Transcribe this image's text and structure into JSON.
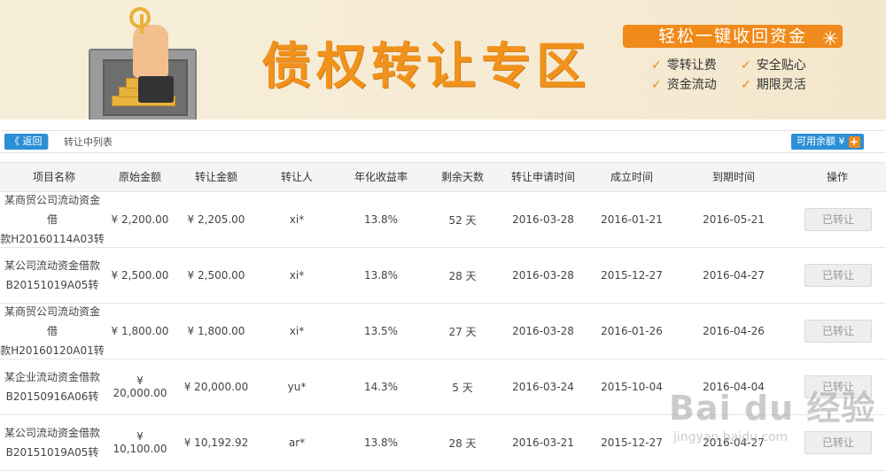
{
  "banner": {
    "title": "债权转让专区",
    "slogan": "轻松一键收回资金",
    "features": [
      "零转让费",
      "安全贴心",
      "资金流动",
      "期限灵活"
    ]
  },
  "toolbar": {
    "back_label": "《 返回",
    "list_label": "转让中列表",
    "balance_label": "可用余额 ¥"
  },
  "table": {
    "headers": [
      "项目名称",
      "原始金额",
      "转让金额",
      "转让人",
      "年化收益率",
      "剩余天数",
      "转让申请时间",
      "成立时间",
      "到期时间",
      "操作"
    ],
    "rows": [
      {
        "name_line1": "某商贸公司流动资金借",
        "name_line2": "款H20160114A03转",
        "original": "¥ 2,200.00",
        "transfer": "¥ 2,205.00",
        "assignor": "xi*",
        "rate": "13.8%",
        "days": "52 天",
        "apply": "2016-03-28",
        "start": "2016-01-21",
        "due": "2016-05-21",
        "action": "已转让"
      },
      {
        "name_line1": "某公司流动资金借款",
        "name_line2": "B20151019A05转",
        "original": "¥ 2,500.00",
        "transfer": "¥ 2,500.00",
        "assignor": "xi*",
        "rate": "13.8%",
        "days": "28 天",
        "apply": "2016-03-28",
        "start": "2015-12-27",
        "due": "2016-04-27",
        "action": "已转让"
      },
      {
        "name_line1": "某商贸公司流动资金借",
        "name_line2": "款H20160120A01转",
        "original": "¥ 1,800.00",
        "transfer": "¥ 1,800.00",
        "assignor": "xi*",
        "rate": "13.5%",
        "days": "27 天",
        "apply": "2016-03-28",
        "start": "2016-01-26",
        "due": "2016-04-26",
        "action": "已转让"
      },
      {
        "name_line1": "某企业流动资金借款",
        "name_line2": "B20150916A06转",
        "original": "¥ 20,000.00",
        "transfer": "¥ 20,000.00",
        "assignor": "yu*",
        "rate": "14.3%",
        "days": "5 天",
        "apply": "2016-03-24",
        "start": "2015-10-04",
        "due": "2016-04-04",
        "action": "已转让"
      },
      {
        "name_line1": "某公司流动资金借款",
        "name_line2": "B20151019A05转",
        "original": "¥ 10,100.00",
        "transfer": "¥ 10,192.92",
        "assignor": "ar*",
        "rate": "13.8%",
        "days": "28 天",
        "apply": "2016-03-21",
        "start": "2015-12-27",
        "due": "2016-04-27",
        "action": "已转让"
      }
    ]
  },
  "watermark": {
    "text": "Bai du 经验",
    "sub": "jingyan.baidu.com"
  }
}
